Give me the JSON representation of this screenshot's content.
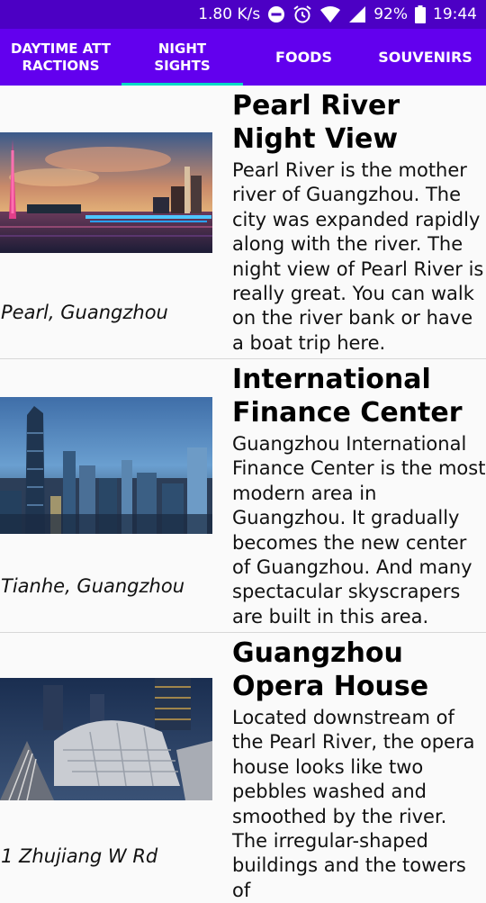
{
  "status_bar": {
    "speed": "1.80 K/s",
    "battery": "92%",
    "time": "19:44",
    "icons": [
      "do-not-disturb-icon",
      "alarm-icon",
      "wifi-icon",
      "signal-icon",
      "battery-icon"
    ]
  },
  "tabs": [
    {
      "label": "DAYTIME ATT\nRACTIONS",
      "selected": false
    },
    {
      "label": "NIGHT\nSIGHTS",
      "selected": true
    },
    {
      "label": "FOODS",
      "selected": false
    },
    {
      "label": "SOUVENIRS",
      "selected": false
    }
  ],
  "colors": {
    "status_bar": "#4c00c4",
    "toolbar": "#6200ee",
    "indicator": "#03dac5",
    "background": "#fafafa"
  },
  "items": [
    {
      "title": "Pearl River Night View",
      "location": "Pearl, Guangzhou",
      "description": "Pearl River is the mother river of Guangzhou. The city was expanded rapidly along with the river. The night view of Pearl River is really great. You can walk on the river bank or have a boat trip here."
    },
    {
      "title": "International Finance Center",
      "location": "Tianhe, Guangzhou",
      "description": "Guangzhou International Finance Center is the most modern area in Guangzhou. It gradually becomes the new center of Guangzhou. And many spectacular skyscrapers are built in this area."
    },
    {
      "title": "Guangzhou Opera House",
      "location": "1 Zhujiang W Rd",
      "description": "Located downstream of the Pearl River, the opera house looks like two pebbles washed and smoothed by the river. The irregular-shaped buildings and the towers of"
    }
  ]
}
